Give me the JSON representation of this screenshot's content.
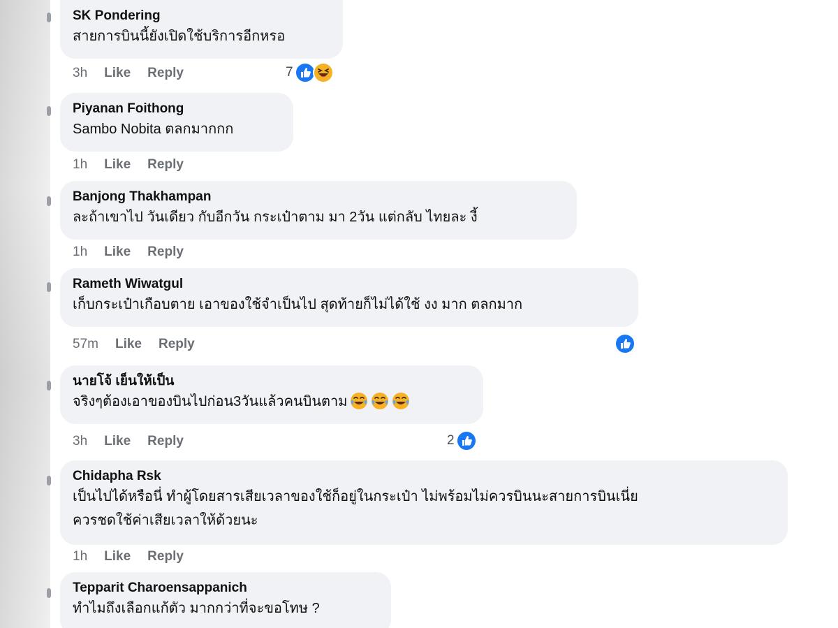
{
  "comments": [
    {
      "author": "SK Pondering",
      "text": "สายการบินนี้ยังเปิดใช้บริการอีกหรอ",
      "time": "3h",
      "like_label": "Like",
      "reply_label": "Reply",
      "reaction_count": "7",
      "reactions": [
        "like-icon",
        "laugh-icon"
      ]
    },
    {
      "author": "Piyanan Foithong",
      "text": "Sambo Nobita ตลกมากกก",
      "time": "1h",
      "like_label": "Like",
      "reply_label": "Reply"
    },
    {
      "author": "Banjong Thakhampan",
      "text": "ละถ้าเขาไป วันเดียว กับอีกวัน กระเป๋าตาม มา 2วัน แต่กลับ ไทยละ งี้",
      "time": "1h",
      "like_label": "Like",
      "reply_label": "Reply"
    },
    {
      "author": "Rameth Wiwatgul",
      "text": "เก็บกระเป๋าเกือบตาย เอาของใช้จำเป็นไป สุดท้ายก็ไม่ได้ใช้ งง มาก ตลกมาก",
      "time": "57m",
      "like_label": "Like",
      "reply_label": "Reply",
      "reactions": [
        "like-icon"
      ]
    },
    {
      "author": "นายโจ้ เย็นให้เป็น",
      "text": "จริงๆต้องเอาของบินไปก่อน3วันแล้วคนบินตาม",
      "emojis": [
        "tears-of-joy-emoji",
        "tears-of-joy-emoji",
        "tears-of-joy-emoji"
      ],
      "time": "3h",
      "like_label": "Like",
      "reply_label": "Reply",
      "reaction_count": "2",
      "reactions": [
        "like-icon"
      ]
    },
    {
      "author": "Chidapha Rsk",
      "text_line1": "เป็นไปได้หรือนี่ ทำผู้โดยสารเสียเวลาของใช้ก็อยู่ในกระเป๋า ไม่พร้อมไม่ควรบินนะสายการบินเนี่ย",
      "text_line2": "ควรชดใช้ค่าเสียเวลาให้ด้วยนะ",
      "time": "1h",
      "like_label": "Like",
      "reply_label": "Reply"
    },
    {
      "author": "Tepparit Charoensappanich",
      "text": "ทำไมถึงเลือกแก้ตัว มากกว่าที่จะขอโทษ ?"
    }
  ],
  "colors": {
    "bubble": "#f0f2f5",
    "like_blue": "#1877f2",
    "muted": "#6b6f75",
    "laugh_yellow": "#f7b125"
  }
}
